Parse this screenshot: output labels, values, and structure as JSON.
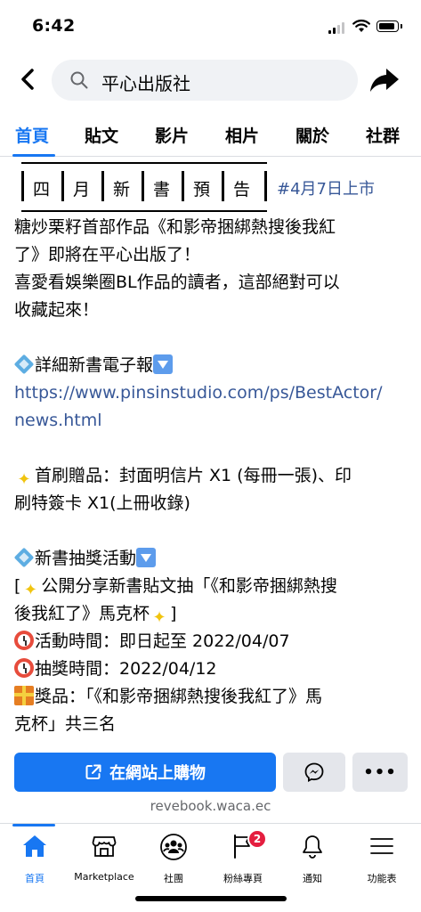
{
  "status_bar": {
    "time": "6:42"
  },
  "header": {
    "search_text": "平心出版社"
  },
  "tabs": [
    "首頁",
    "貼文",
    "影片",
    "相片",
    "關於",
    "社群"
  ],
  "post": {
    "banner_chars": [
      "四",
      "月",
      "新",
      "書",
      "預",
      "告"
    ],
    "hashtag": "#4月7日上市",
    "intro_lines": [
      "糖炒栗籽首部作品《和影帝捆綁熱搜後我紅",
      "了》即將在平心出版了！",
      "喜愛看娛樂圈BL作品的讀者，這部絕對可以",
      "收藏起來！"
    ],
    "ebook_title": "詳細新書電子報",
    "ebook_link_lines": [
      "https://www.pinsinstudio.com/ps/BestActor/",
      "news.html"
    ],
    "gift_lines": [
      "首刷贈品：封面明信片 X1 (每冊一張)、印",
      "刷特簽卡 X1(上冊收錄)"
    ],
    "lottery_title": "新書抽獎活動",
    "lottery_line1_pre": "[",
    "lottery_line1_text": "公開分享新書貼文抽「《和影帝捆綁熱搜",
    "lottery_line2_text": "後我紅了》馬克杯",
    "lottery_line2_post": "]",
    "activity_time": "活動時間：即日起至 2022/04/07",
    "draw_time": "抽獎時間：2022/04/12",
    "prize_lines": [
      "獎品：「《和影帝捆綁熱搜後我紅了》馬",
      "克杯」共三名"
    ]
  },
  "actions": {
    "buy_label": "在網站上購物",
    "more_label": "•••",
    "website": "revebook.waca.ec"
  },
  "bottom_nav": [
    {
      "label": "首頁",
      "icon": "home-icon"
    },
    {
      "label": "Marketplace",
      "icon": "marketplace-icon"
    },
    {
      "label": "社團",
      "icon": "groups-icon"
    },
    {
      "label": "粉絲專頁",
      "icon": "pages-icon",
      "badge": "2"
    },
    {
      "label": "通知",
      "icon": "bell-icon"
    },
    {
      "label": "功能表",
      "icon": "menu-icon"
    }
  ],
  "colors": {
    "accent": "#1877f2",
    "link": "#385898",
    "badge": "#e41e3f"
  }
}
